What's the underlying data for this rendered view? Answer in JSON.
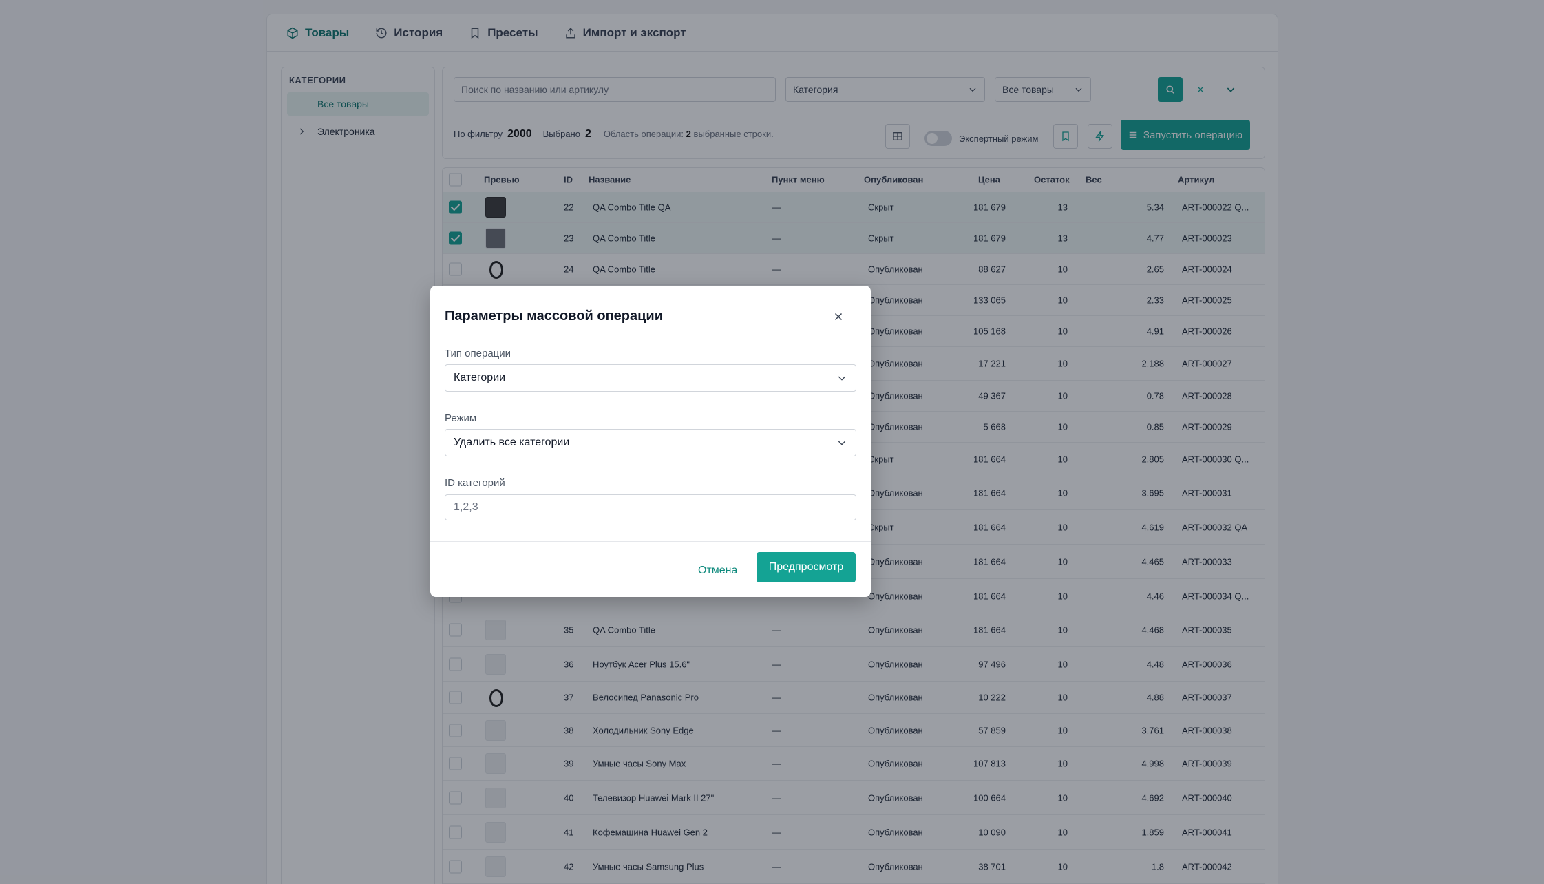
{
  "tabs": [
    {
      "label": "Товары",
      "icon": "box-icon"
    },
    {
      "label": "История",
      "icon": "history-icon"
    },
    {
      "label": "Пресеты",
      "icon": "bookmark-icon"
    },
    {
      "label": "Импорт и экспорт",
      "icon": "upload-icon"
    }
  ],
  "sidebar": {
    "heading": "КАТЕГОРИИ",
    "all_label": "Все товары",
    "tree_item": "Электроника"
  },
  "filters": {
    "search_placeholder": "Поиск по названию или артикулу",
    "category_value": "Категория",
    "status_value": "Все товары",
    "by_filter_label": "По фильтру",
    "by_filter_count": "2000",
    "selected_label": "Выбрано",
    "selected_count": "2",
    "scope_prefix": "Область операции:",
    "scope_count": "2",
    "scope_suffix": "выбранные строки.",
    "expert_mode_label": "Экспертный режим",
    "run_label": "Запустить операцию"
  },
  "table": {
    "columns": [
      "Превью",
      "ID",
      "Название",
      "Пункт меню",
      "Опубликован",
      "Цена",
      "Остаток",
      "Вес",
      "Артикул"
    ],
    "rows": [
      {
        "id": "22",
        "name": "QA Combo Title QA",
        "menu": "—",
        "pub": "Скрыт",
        "price": "181 679",
        "stock": "13",
        "weight": "5.34",
        "art": "ART-000022 Q..."
      },
      {
        "id": "23",
        "name": "QA Combo Title",
        "menu": "—",
        "pub": "Скрыт",
        "price": "181 679",
        "stock": "13",
        "weight": "4.77",
        "art": "ART-000023"
      },
      {
        "id": "24",
        "name": "QA Combo Title",
        "menu": "—",
        "pub": "Опубликован",
        "price": "88 627",
        "stock": "10",
        "weight": "2.65",
        "art": "ART-000024"
      },
      {
        "id": "",
        "name": "",
        "menu": "",
        "pub": "Опубликован",
        "price": "133 065",
        "stock": "10",
        "weight": "2.33",
        "art": "ART-000025"
      },
      {
        "id": "",
        "name": "",
        "menu": "",
        "pub": "Опубликован",
        "price": "105 168",
        "stock": "10",
        "weight": "4.91",
        "art": "ART-000026"
      },
      {
        "id": "",
        "name": "",
        "menu": "",
        "pub": "Опубликован",
        "price": "17 221",
        "stock": "10",
        "weight": "2.188",
        "art": "ART-000027"
      },
      {
        "id": "",
        "name": "",
        "menu": "",
        "pub": "Опубликован",
        "price": "49 367",
        "stock": "10",
        "weight": "0.78",
        "art": "ART-000028"
      },
      {
        "id": "",
        "name": "",
        "menu": "",
        "pub": "Опубликован",
        "price": "5 668",
        "stock": "10",
        "weight": "0.85",
        "art": "ART-000029"
      },
      {
        "id": "",
        "name": "",
        "menu": "",
        "pub": "Скрыт",
        "price": "181 664",
        "stock": "10",
        "weight": "2.805",
        "art": "ART-000030 Q..."
      },
      {
        "id": "",
        "name": "",
        "menu": "",
        "pub": "Опубликован",
        "price": "181 664",
        "stock": "10",
        "weight": "3.695",
        "art": "ART-000031"
      },
      {
        "id": "",
        "name": "",
        "menu": "",
        "pub": "Скрыт",
        "price": "181 664",
        "stock": "10",
        "weight": "4.619",
        "art": "ART-000032 QA"
      },
      {
        "id": "",
        "name": "",
        "menu": "",
        "pub": "Опубликован",
        "price": "181 664",
        "stock": "10",
        "weight": "4.465",
        "art": "ART-000033"
      },
      {
        "id": "",
        "name": "",
        "menu": "",
        "pub": "Опубликован",
        "price": "181 664",
        "stock": "10",
        "weight": "4.46",
        "art": "ART-000034 Q..."
      },
      {
        "id": "35",
        "name": "QA Combo Title",
        "menu": "—",
        "pub": "Опубликован",
        "price": "181 664",
        "stock": "10",
        "weight": "4.468",
        "art": "ART-000035"
      },
      {
        "id": "36",
        "name": "Ноутбук Acer Plus 15.6\"",
        "menu": "—",
        "pub": "Опубликован",
        "price": "97 496",
        "stock": "10",
        "weight": "4.48",
        "art": "ART-000036"
      },
      {
        "id": "37",
        "name": "Велосипед Panasonic Pro",
        "menu": "—",
        "pub": "Опубликован",
        "price": "10 222",
        "stock": "10",
        "weight": "4.88",
        "art": "ART-000037"
      },
      {
        "id": "38",
        "name": "Холодильник Sony Edge",
        "menu": "—",
        "pub": "Опубликован",
        "price": "57 859",
        "stock": "10",
        "weight": "3.761",
        "art": "ART-000038"
      },
      {
        "id": "39",
        "name": "Умные часы Sony Max",
        "menu": "—",
        "pub": "Опубликован",
        "price": "107 813",
        "stock": "10",
        "weight": "4.998",
        "art": "ART-000039"
      },
      {
        "id": "40",
        "name": "Телевизор Huawei Mark II 27\"",
        "menu": "—",
        "pub": "Опубликован",
        "price": "100 664",
        "stock": "10",
        "weight": "4.692",
        "art": "ART-000040"
      },
      {
        "id": "41",
        "name": "Кофемашина Huawei Gen 2",
        "menu": "—",
        "pub": "Опубликован",
        "price": "10 090",
        "stock": "10",
        "weight": "1.859",
        "art": "ART-000041"
      },
      {
        "id": "42",
        "name": "Умные часы Samsung Plus",
        "menu": "—",
        "pub": "Опубликован",
        "price": "38 701",
        "stock": "10",
        "weight": "1.8",
        "art": "ART-000042"
      }
    ]
  },
  "modal": {
    "title": "Параметры массовой операции",
    "op_type_label": "Тип операции",
    "op_type_value": "Категории",
    "mode_label": "Режим",
    "mode_value": "Удалить все категории",
    "ids_label": "ID категорий",
    "ids_placeholder": "1,2,3",
    "cancel_label": "Отмена",
    "preview_label": "Предпросмотр"
  },
  "colors": {
    "accent": "#14a394",
    "accent_text": "#0f766e"
  }
}
